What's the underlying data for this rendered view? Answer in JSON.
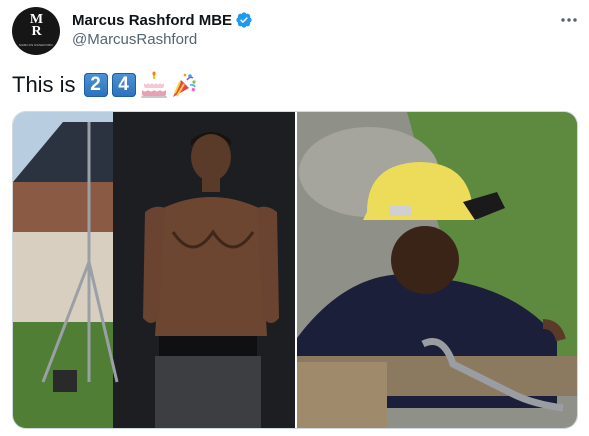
{
  "author": {
    "display_name": "Marcus Rashford MBE",
    "handle": "@MarcusRashford",
    "verified": true,
    "avatar_logo_top": "M",
    "avatar_logo_bottom": "R",
    "avatar_subtitle": "MARCUS RASHFORD"
  },
  "tweet": {
    "text": "This is",
    "keycaps": [
      "2",
      "4"
    ],
    "emojis": [
      "birthday-cake-emoji",
      "party-popper-emoji"
    ]
  },
  "icons": {
    "verified": "verified-badge-icon",
    "more": "more-options-icon"
  },
  "colors": {
    "verified_blue": "#1d9bf0",
    "secondary_text": "#536471",
    "keycap_blue": "#3b82c8"
  },
  "media": {
    "photos": [
      "photo-adult",
      "photo-child"
    ]
  }
}
